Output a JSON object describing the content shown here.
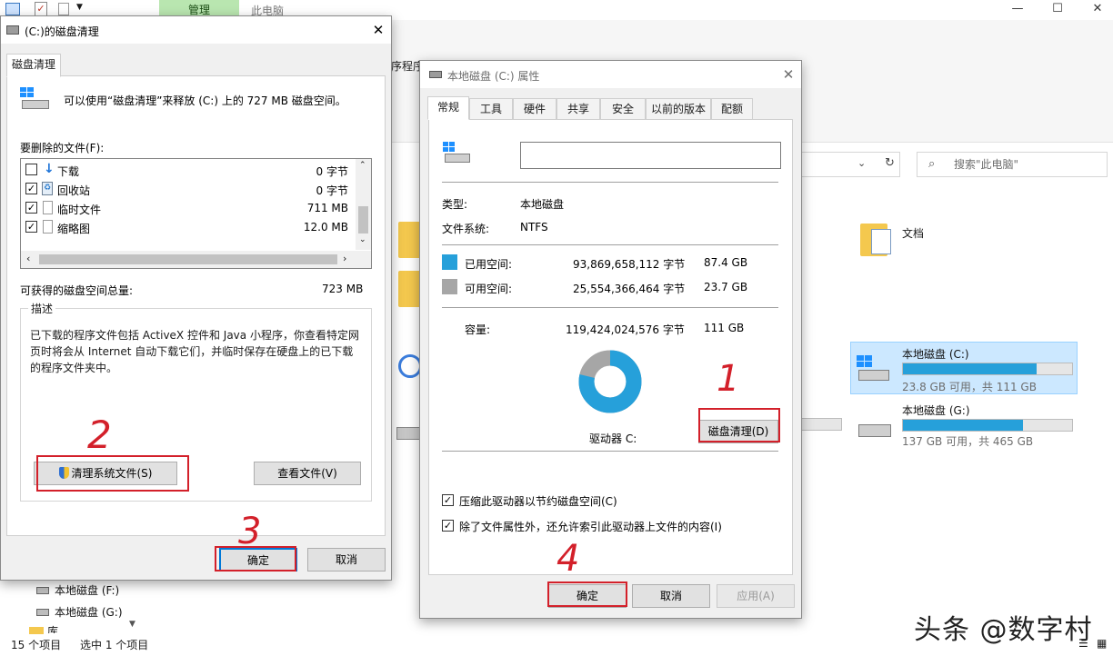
{
  "explorer": {
    "ribbon_context_tab": "管理",
    "window_title": "此电脑",
    "ribbon_partial_label": "序程序",
    "search_placeholder": "搜索\"此电脑\"",
    "folder_documents": "文档",
    "drives": [
      {
        "name": "本地磁盘 (C:)",
        "info": "23.8 GB 可用，共 111 GB",
        "used_fraction": 0.79
      },
      {
        "name": "本地磁盘 (G:)",
        "info": "137 GB 可用，共 465 GB",
        "used_fraction": 0.71
      }
    ],
    "nav_items": [
      "本地磁盘 (F:)",
      "本地磁盘 (G:)",
      "库"
    ],
    "status_items": "15 个项目",
    "status_selected": "选中 1 个项目",
    "watermark": "头条 @数字村"
  },
  "cleanup": {
    "title": "(C:)的磁盘清理",
    "tab": "磁盘清理",
    "intro": "可以使用“磁盘清理”来释放 (C:) 上的 727 MB 磁盘空间。",
    "files_label": "要删除的文件(F):",
    "files": [
      {
        "name": "下载",
        "size": "0 字节",
        "checked": false,
        "icon": "download-arrow-icon"
      },
      {
        "name": "回收站",
        "size": "0 字节",
        "checked": true,
        "icon": "recycle-bin-icon"
      },
      {
        "name": "临时文件",
        "size": "711 MB",
        "checked": true,
        "icon": "file-icon"
      },
      {
        "name": "缩略图",
        "size": "12.0 MB",
        "checked": true,
        "icon": "file-icon"
      }
    ],
    "total_label": "可获得的磁盘空间总量:",
    "total_value": "723 MB",
    "desc_legend": "描述",
    "desc_text": "已下载的程序文件包括 ActiveX 控件和 Java 小程序，你查看特定网页时将会从 Internet 自动下载它们，并临时保存在硬盘上的已下载的程序文件夹中。",
    "btn_clean_system": "清理系统文件(S)",
    "btn_view_files": "查看文件(V)",
    "btn_ok": "确定",
    "btn_cancel": "取消"
  },
  "props": {
    "title": "本地磁盘 (C:) 属性",
    "tabs": [
      "常规",
      "工具",
      "硬件",
      "共享",
      "安全",
      "以前的版本",
      "配额"
    ],
    "name_value": "",
    "type_label": "类型:",
    "type_value": "本地磁盘",
    "fs_label": "文件系统:",
    "fs_value": "NTFS",
    "used_label": "已用空间:",
    "used_bytes": "93,869,658,112 字节",
    "used_gb": "87.4 GB",
    "free_label": "可用空间:",
    "free_bytes": "25,554,366,464 字节",
    "free_gb": "23.7 GB",
    "cap_label": "容量:",
    "cap_bytes": "119,424,024,576 字节",
    "cap_gb": "111 GB",
    "drive_label": "驱动器 C:",
    "btn_cleanup": "磁盘清理(D)",
    "compress_label": "压缩此驱动器以节约磁盘空间(C)",
    "index_label": "除了文件属性外，还允许索引此驱动器上文件的内容(I)",
    "btn_ok": "确定",
    "btn_cancel": "取消",
    "btn_apply": "应用(A)",
    "used_fraction": 0.786,
    "colors": {
      "used": "#26a0da",
      "free": "#a6a6a6"
    }
  },
  "annotations": {
    "numbers": [
      "1",
      "2",
      "3",
      "4"
    ],
    "color": "#d3202a"
  }
}
